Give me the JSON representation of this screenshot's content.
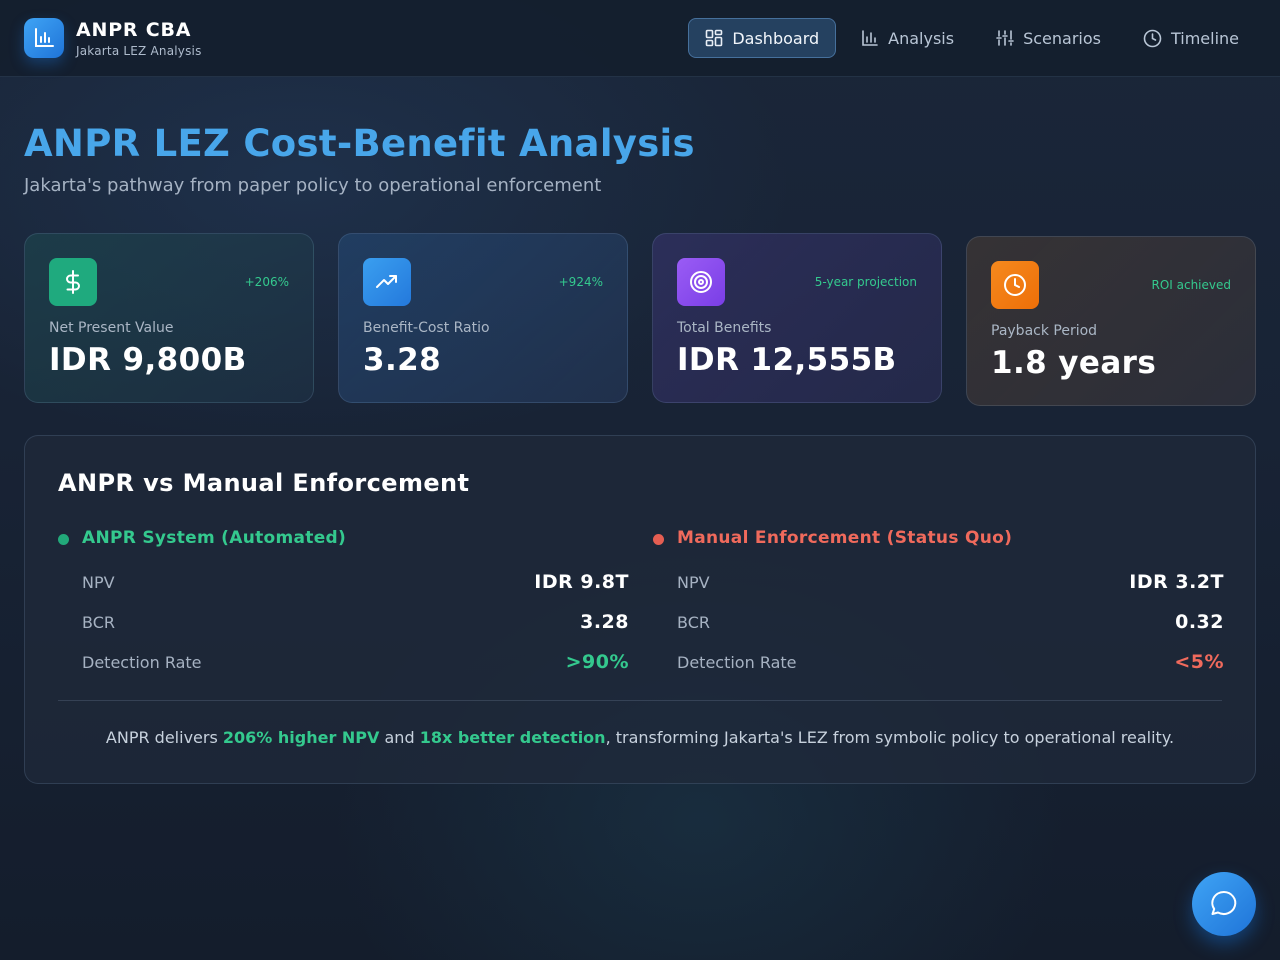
{
  "header": {
    "brand_title": "ANPR CBA",
    "brand_subtitle": "Jakarta LEZ Analysis",
    "nav": [
      {
        "label": "Dashboard",
        "icon": "grid-icon",
        "active": true
      },
      {
        "label": "Analysis",
        "icon": "bar-chart-icon",
        "active": false
      },
      {
        "label": "Scenarios",
        "icon": "sliders-icon",
        "active": false
      },
      {
        "label": "Timeline",
        "icon": "clock-icon",
        "active": false
      }
    ]
  },
  "hero": {
    "title": "ANPR LEZ Cost-Benefit Analysis",
    "subtitle": "Jakarta's pathway from paper policy to operational enforcement"
  },
  "kpis": [
    {
      "label": "Net Present Value",
      "value": "IDR 9,800B",
      "badge": "+206%",
      "icon": "dollar-icon",
      "color": "#1faa7e"
    },
    {
      "label": "Benefit-Cost Ratio",
      "value": "3.28",
      "badge": "+924%",
      "icon": "trending-up-icon",
      "color": "#2d8fe6"
    },
    {
      "label": "Total Benefits",
      "value": "IDR 12,555B",
      "badge": "5-year projection",
      "icon": "target-icon",
      "color": "#8a4cf0"
    },
    {
      "label": "Payback Period",
      "value": "1.8 years",
      "badge": "ROI achieved",
      "icon": "clock-icon",
      "color": "#f07c12"
    }
  ],
  "comparison": {
    "title": "ANPR vs Manual Enforcement",
    "anpr": {
      "heading": "ANPR System (Automated)",
      "metrics": [
        {
          "label": "NPV",
          "value": "IDR 9.8T"
        },
        {
          "label": "BCR",
          "value": "3.28"
        },
        {
          "label": "Detection Rate",
          "value": ">90%"
        }
      ]
    },
    "manual": {
      "heading": "Manual Enforcement (Status Quo)",
      "metrics": [
        {
          "label": "NPV",
          "value": "IDR 3.2T"
        },
        {
          "label": "BCR",
          "value": "0.32"
        },
        {
          "label": "Detection Rate",
          "value": "<5%"
        }
      ]
    },
    "summary": {
      "prefix": "ANPR delivers ",
      "highlight1": "206% higher NPV",
      "middle": " and ",
      "highlight2": "18x better detection",
      "suffix": ", transforming Jakarta's LEZ from symbolic policy to operational reality."
    }
  },
  "chat": {
    "icon": "chat-bubble-icon"
  },
  "colors": {
    "accent": "#48a6ea",
    "positive": "#34c98e",
    "negative": "#f06a5c"
  }
}
